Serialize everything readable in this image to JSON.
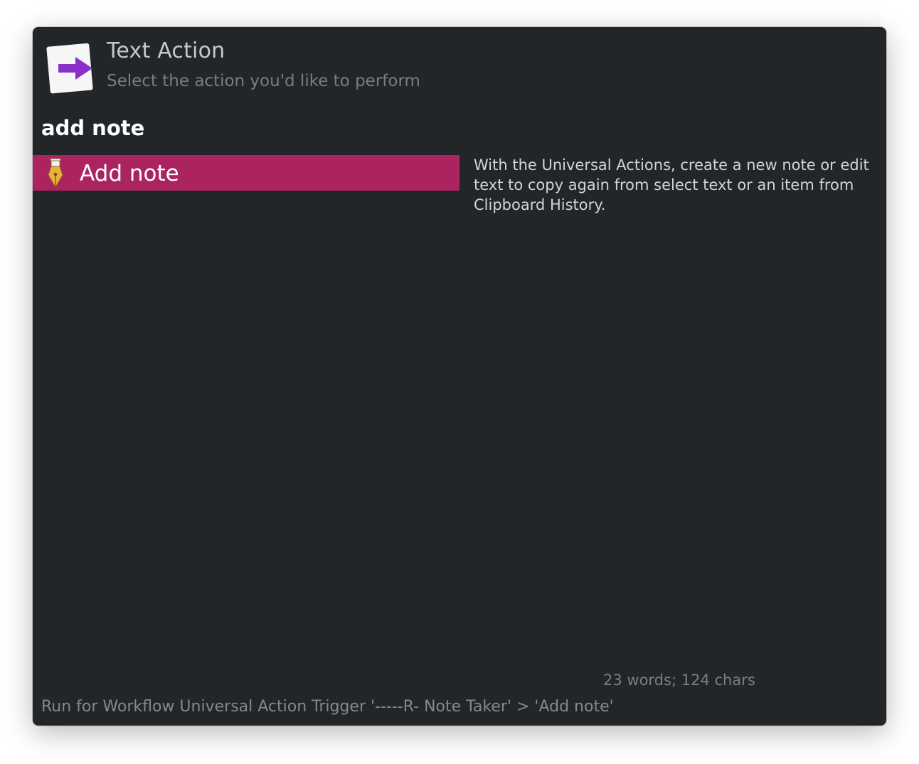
{
  "header": {
    "icon": "text-action-arrow-icon",
    "title": "Text Action",
    "subtitle": "Select the action you'd like to perform"
  },
  "query": "add note",
  "results": [
    {
      "icon": "fountain-pen-icon",
      "label": "Add note",
      "selected": true
    }
  ],
  "preview": {
    "text": "With the Universal Actions, create a new note or edit text to copy again from select text or an item from Clipboard History.",
    "stats": "23 words; 124 chars"
  },
  "footer": {
    "text": "Run for Workflow Universal Action Trigger '-----R- Note Taker' > 'Add note'"
  },
  "colors": {
    "window_bg": "#232629",
    "selection": "#ab2460",
    "arrow": "#8b2fc9",
    "pen_gold": "#e8b23a"
  }
}
